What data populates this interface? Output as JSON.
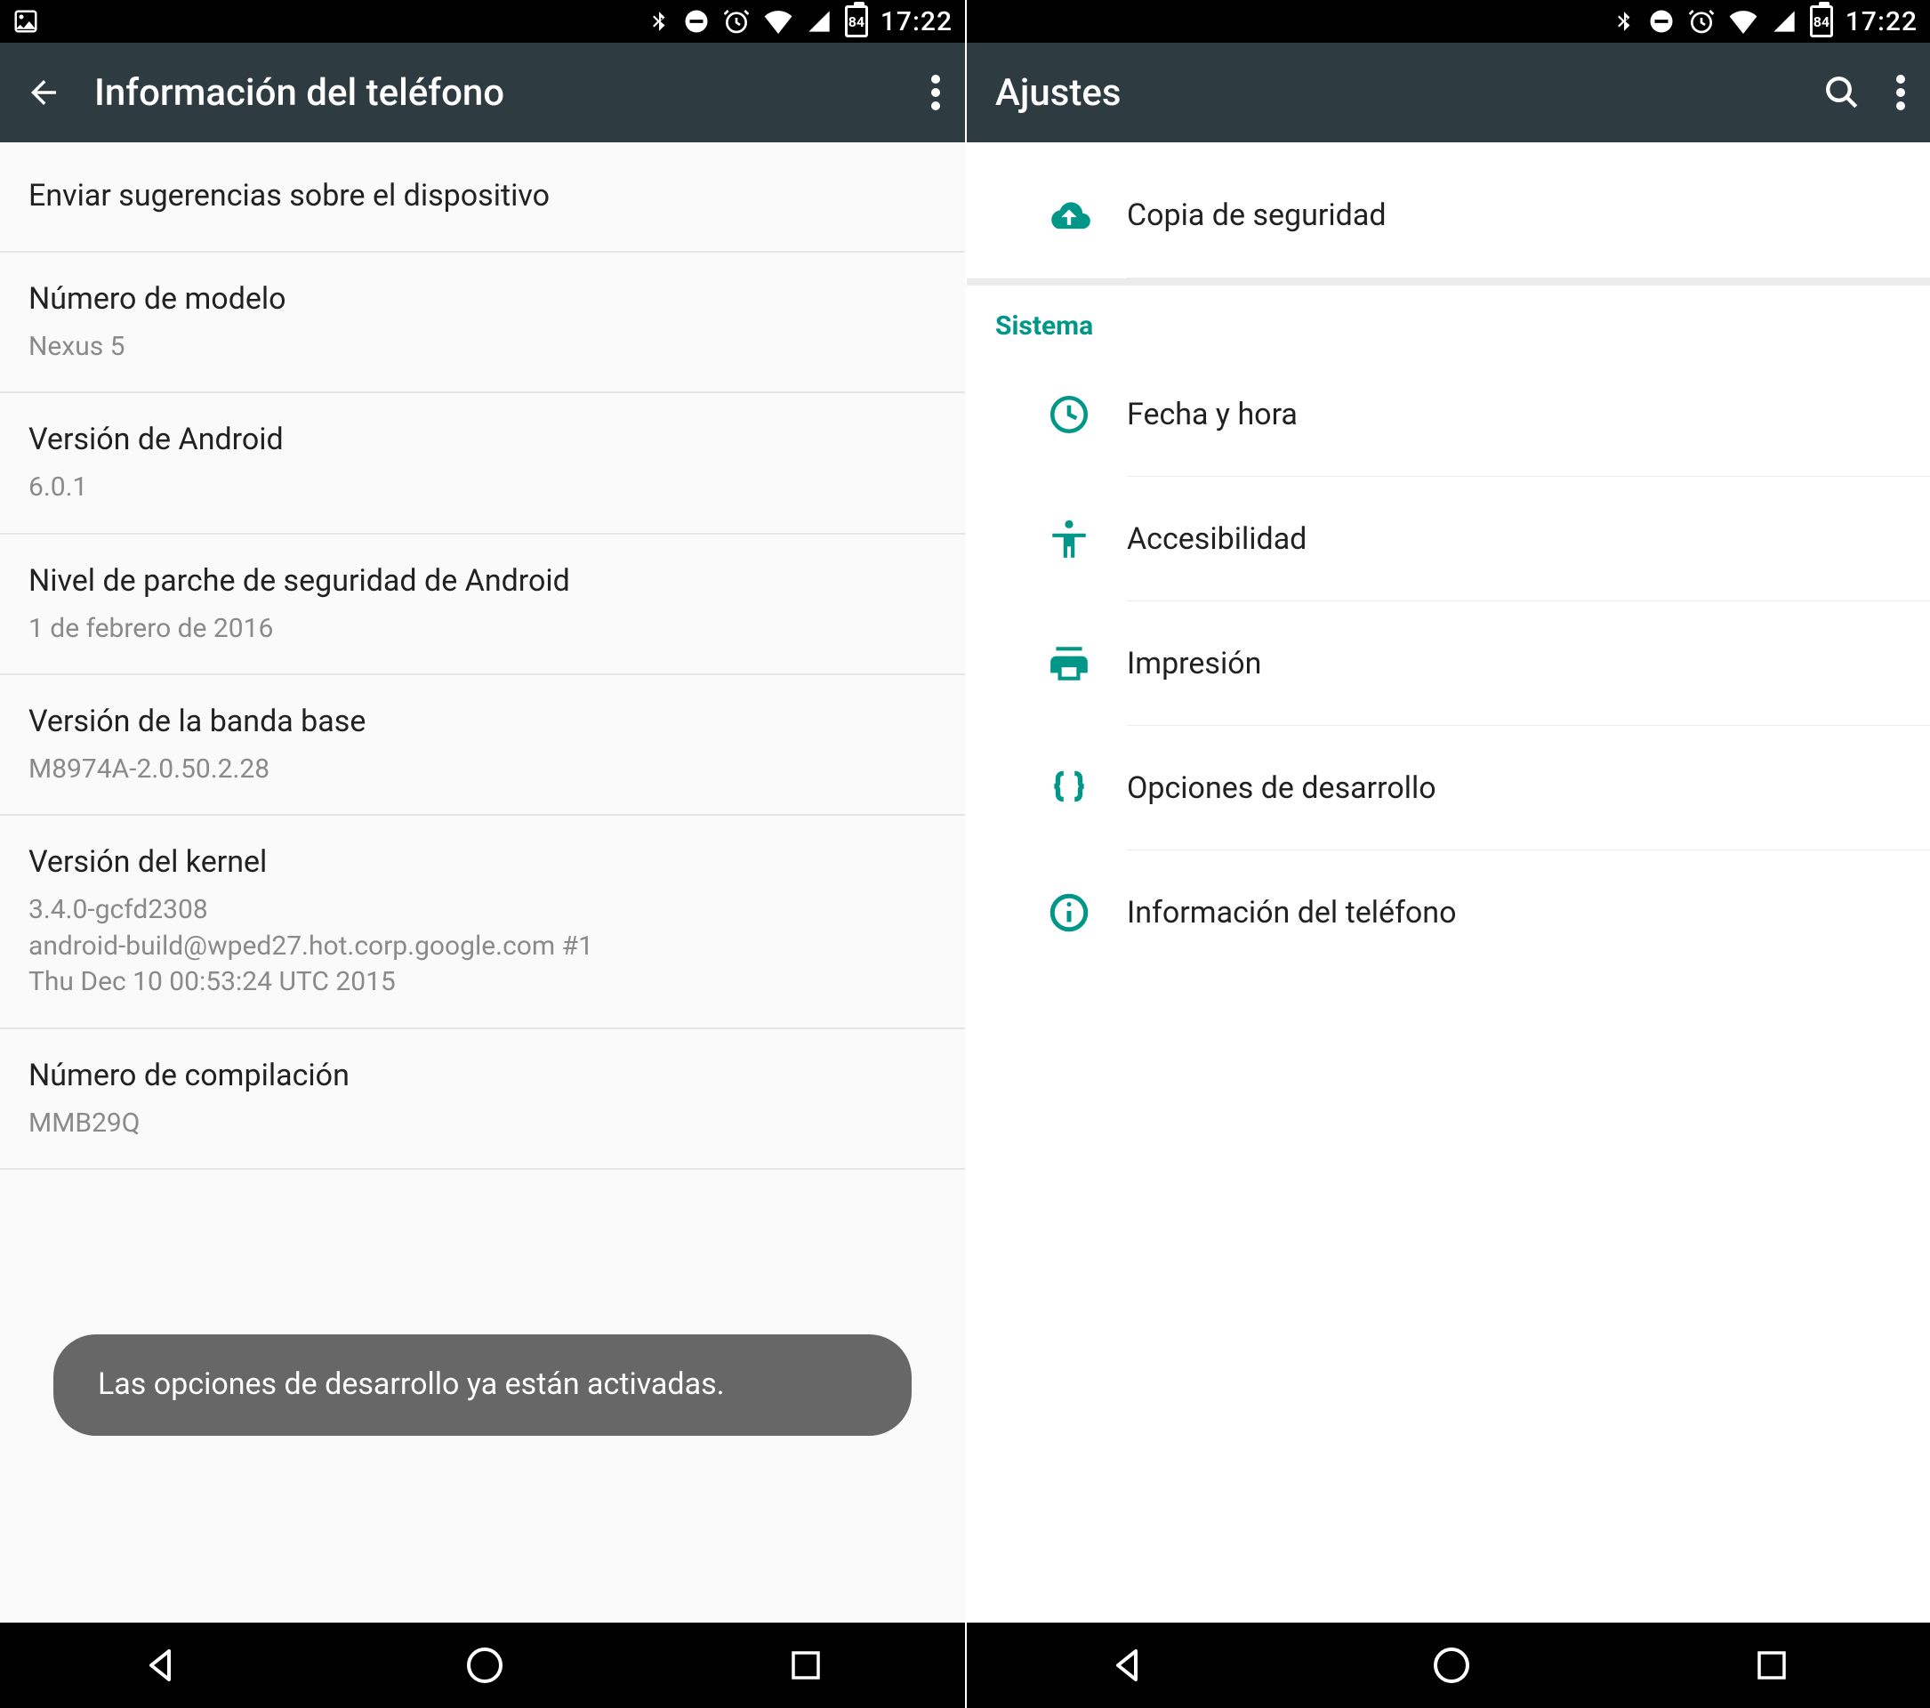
{
  "status": {
    "battery": "84",
    "time": "17:22"
  },
  "left": {
    "appbar_title": "Información del teléfono",
    "items": [
      {
        "title": "Enviar sugerencias sobre el dispositivo",
        "sub": null
      },
      {
        "title": "Número de modelo",
        "sub": "Nexus 5"
      },
      {
        "title": "Versión de Android",
        "sub": "6.0.1"
      },
      {
        "title": "Nivel de parche de seguridad de Android",
        "sub": "1 de febrero de 2016"
      },
      {
        "title": "Versión de la banda base",
        "sub": "M8974A-2.0.50.2.28"
      },
      {
        "title": "Versión del kernel",
        "sub": "3.4.0-gcfd2308\nandroid-build@wped27.hot.corp.google.com #1\nThu Dec 10 00:53:24 UTC 2015"
      },
      {
        "title": "Número de compilación",
        "sub": "MMB29Q"
      }
    ],
    "toast": "Las opciones de desarrollo ya están activadas."
  },
  "right": {
    "appbar_title": "Ajustes",
    "backup_label": "Copia de seguridad",
    "section_header": "Sistema",
    "items": [
      {
        "label": "Fecha y hora",
        "icon": "clock"
      },
      {
        "label": "Accesibilidad",
        "icon": "accessibility"
      },
      {
        "label": "Impresión",
        "icon": "print"
      },
      {
        "label": "Opciones de desarrollo",
        "icon": "braces"
      },
      {
        "label": "Información del teléfono",
        "icon": "info"
      }
    ]
  }
}
